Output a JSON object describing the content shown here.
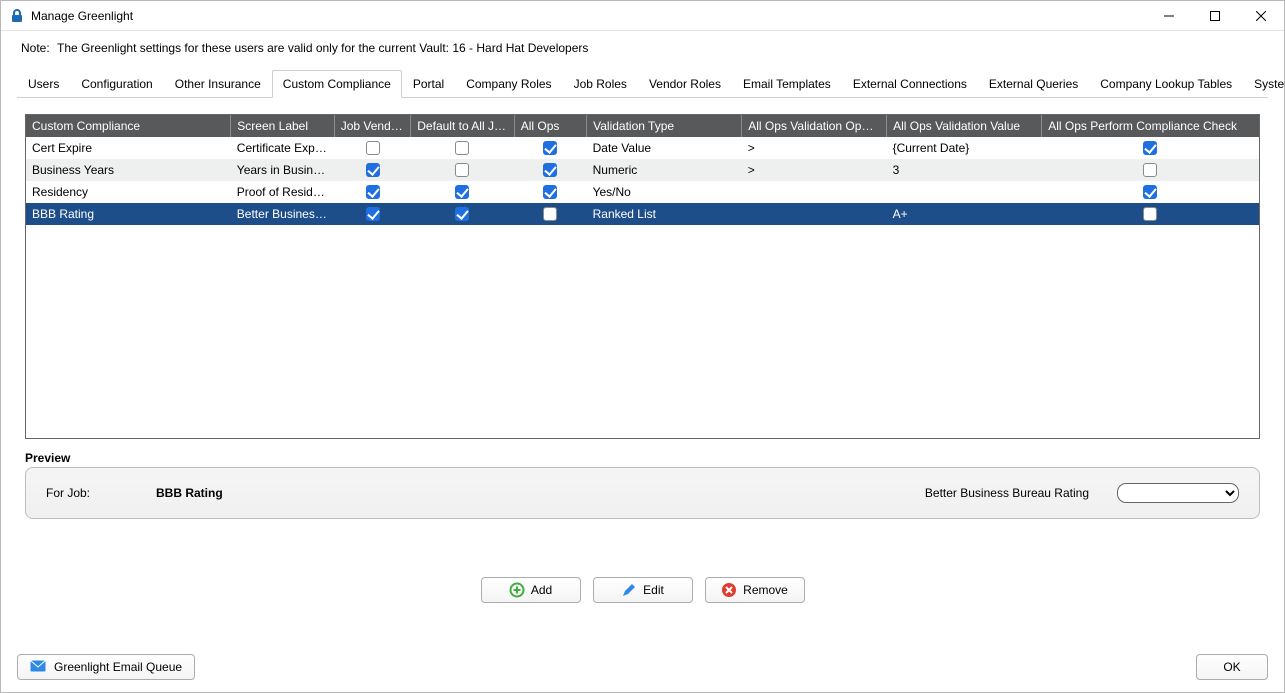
{
  "window": {
    "title": "Manage Greenlight"
  },
  "note": {
    "label": "Note:",
    "text": "The Greenlight settings for these users are valid only for the current Vault: 16 - Hard Hat Developers"
  },
  "tabs": {
    "items": [
      {
        "label": "Users"
      },
      {
        "label": "Configuration"
      },
      {
        "label": "Other Insurance"
      },
      {
        "label": "Custom Compliance"
      },
      {
        "label": "Portal"
      },
      {
        "label": "Company Roles"
      },
      {
        "label": "Job Roles"
      },
      {
        "label": "Vendor Roles"
      },
      {
        "label": "Email Templates"
      },
      {
        "label": "External Connections"
      },
      {
        "label": "External Queries"
      },
      {
        "label": "Company Lookup Tables"
      },
      {
        "label": "System Lookup Tables"
      }
    ],
    "active_index": 3
  },
  "table": {
    "columns": [
      "Custom Compliance",
      "Screen Label",
      "Job Vendors",
      "Default to All Jobs",
      "All Ops",
      "Validation Type",
      "All Ops Validation Operator",
      "All Ops Validation Value",
      "All Ops Perform Compliance Check"
    ],
    "rows": [
      {
        "name": "Cert Expire",
        "label": "Certificate Expirati...",
        "job_vendors": false,
        "default_all": false,
        "all_ops": true,
        "vtype": "Date Value",
        "op": ">",
        "val": "{Current Date}",
        "check": true
      },
      {
        "name": "Business Years",
        "label": "Years in Business",
        "job_vendors": true,
        "default_all": false,
        "all_ops": true,
        "vtype": "Numeric",
        "op": ">",
        "val": "3",
        "check": false
      },
      {
        "name": "Residency",
        "label": "Proof of Residency",
        "job_vendors": true,
        "default_all": true,
        "all_ops": true,
        "vtype": "Yes/No",
        "op": "",
        "val": "",
        "check": true
      },
      {
        "name": "BBB Rating",
        "label": "Better Business B...",
        "job_vendors": true,
        "default_all": true,
        "all_ops": false,
        "vtype": "Ranked List",
        "op": "",
        "val": "A+",
        "check": false
      }
    ],
    "selected_index": 3
  },
  "preview": {
    "heading": "Preview",
    "for_job_label": "For Job:",
    "job_name": "BBB Rating",
    "field_label": "Better Business Bureau Rating",
    "select_value": ""
  },
  "actions": {
    "add": "Add",
    "edit": "Edit",
    "remove": "Remove"
  },
  "footer": {
    "queue": "Greenlight Email Queue",
    "ok": "OK"
  }
}
